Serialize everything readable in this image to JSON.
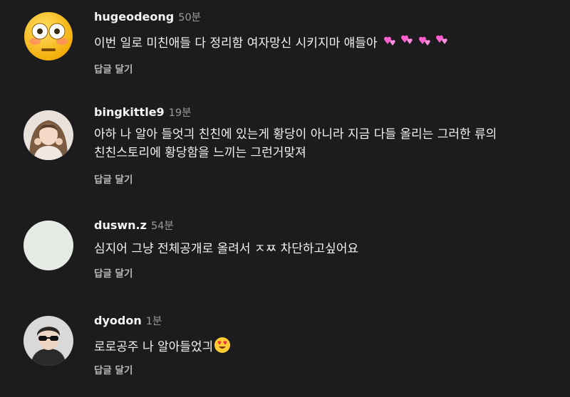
{
  "comments": [
    {
      "username": "hugeodeong",
      "time": "50분",
      "text": "이번 일로 미친애들 다 정리함 여자망신 시키지마 얘들아",
      "emoji_trail": "two-hearts-emoji x4",
      "reply_label": "답글 달기",
      "avatar": "flushed-face-emoji"
    },
    {
      "username": "bingkittle9",
      "time": "19분",
      "text": "아하 나 알아 들엇긔 친친에 있는게 황당이 아니라 지금 다들 올리는 그러한 류의\n친친스토리에 황당함을 느끼는 그런거맞져",
      "reply_label": "답글 달기",
      "avatar": "profile-photo"
    },
    {
      "username": "duswn.z",
      "time": "54분",
      "text": "심지어 그냥 전체공개로 올려서 ㅈㅉ 차단하고싶어요",
      "reply_label": "답글 달기",
      "avatar": "default-avatar",
      "avatar_color": "#e6ebe5"
    },
    {
      "username": "dyodon",
      "time": "1분",
      "text": "로로공주 나 알아들었긔",
      "emoji_trail": "heart-eyes-emoji",
      "reply_label": "답글 달기",
      "avatar": "profile-photo"
    }
  ],
  "colors": {
    "background": "#1c1c1e",
    "text": "#f2f2f2",
    "muted": "#9a9a9a",
    "heart": "#ff5fcf"
  }
}
